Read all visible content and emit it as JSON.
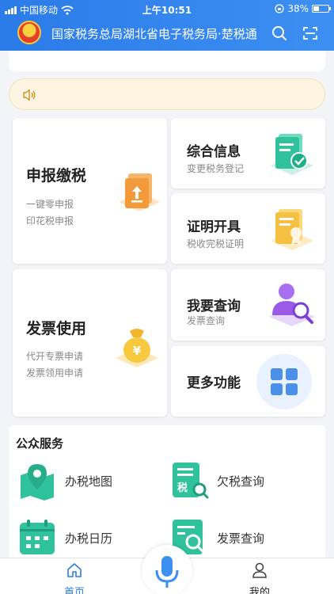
{
  "status_bar": {
    "carrier": "中国移动",
    "time": "上午10:51",
    "battery": "38%",
    "battery_level": 0.38
  },
  "header": {
    "title": "国家税务总局湖北省电子税务局·楚税通"
  },
  "notice": {
    "text": ""
  },
  "cards": {
    "declare": {
      "title": "申报缴税",
      "lines": [
        "一键零申报",
        "印花税申报"
      ]
    },
    "info": {
      "title": "综合信息",
      "sub": "变更税务登记"
    },
    "certificate": {
      "title": "证明开具",
      "sub": "税收完税证明"
    },
    "invoice": {
      "title": "发票使用",
      "lines": [
        "代开专票申请",
        "发票领用申请"
      ]
    },
    "query": {
      "title": "我要查询",
      "sub": "发票查询"
    },
    "more": {
      "title": "更多功能"
    }
  },
  "public_service": {
    "title": "公众服务",
    "items": [
      {
        "label": "办税地图",
        "icon": "map-pin-icon"
      },
      {
        "label": "欠税查询",
        "icon": "tax-search-icon"
      },
      {
        "label": "办税日历",
        "icon": "calendar-icon"
      },
      {
        "label": "发票查询",
        "icon": "invoice-search-icon"
      }
    ]
  },
  "tabbar": {
    "home": "首页",
    "mine": "我的"
  },
  "colors": {
    "brand_blue": "#2b7be8",
    "accent_green": "#2fc29c",
    "notice_bg": "#fdf5e2",
    "orange": "#f39a3b",
    "purple": "#9a5ce6"
  }
}
